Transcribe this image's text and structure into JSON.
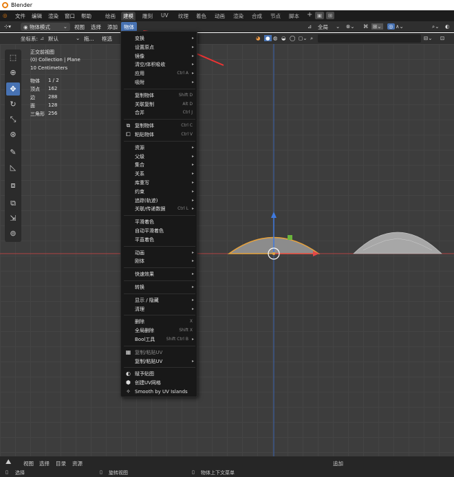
{
  "app": {
    "title": "Blender"
  },
  "topbar": {
    "menus": [
      "文件",
      "编辑",
      "渲染",
      "窗口",
      "帮助"
    ],
    "tabs": [
      "绘画",
      "建模",
      "雕刻",
      "UV",
      "纹理",
      "着色",
      "动画",
      "渲染",
      "合成",
      "节点",
      "脚本"
    ],
    "active_tab": "建模",
    "add_tab": "+"
  },
  "header": {
    "mode": "物体模式",
    "menus": [
      "视图",
      "选择",
      "添加"
    ],
    "active_menu": "物体",
    "orientation": "全局"
  },
  "toolheader": {
    "coord_label": "坐标系:",
    "coord_value": "默认",
    "drag_label": "拖...",
    "select_label": "框选"
  },
  "overlay": {
    "view_name": "正交前视图",
    "collection": "(0) Collection | Plane",
    "scale": "10 Centimeters",
    "stats": [
      {
        "label": "物体",
        "value": "1 / 2"
      },
      {
        "label": "顶点",
        "value": "162"
      },
      {
        "label": "边",
        "value": "288"
      },
      {
        "label": "面",
        "value": "128"
      },
      {
        "label": "三角形",
        "value": "256"
      }
    ]
  },
  "menu": {
    "groups": [
      [
        {
          "label": "变换",
          "submenu": true
        },
        {
          "label": "设置原点",
          "submenu": true
        },
        {
          "label": "镜像",
          "submenu": true
        },
        {
          "label": "清空/体积吸收",
          "submenu": true
        },
        {
          "label": "应用",
          "shortcut": "Ctrl A",
          "submenu": true
        },
        {
          "label": "吸附",
          "submenu": true
        }
      ],
      [
        {
          "label": "复制物体",
          "shortcut": "Shift D"
        },
        {
          "label": "关联复制",
          "shortcut": "Alt D"
        },
        {
          "label": "合并",
          "shortcut": "Ctrl J"
        }
      ],
      [
        {
          "label": "复制物体",
          "shortcut": "Ctrl C",
          "icon": "copy-icon"
        },
        {
          "label": "粘贴物体",
          "shortcut": "Ctrl V",
          "icon": "paste-icon"
        }
      ],
      [
        {
          "label": "资源",
          "submenu": true
        },
        {
          "label": "父级",
          "submenu": true
        },
        {
          "label": "集合",
          "submenu": true
        },
        {
          "label": "关系",
          "submenu": true
        },
        {
          "label": "库重写",
          "submenu": true
        },
        {
          "label": "约束",
          "submenu": true
        },
        {
          "label": "追踪(轨迹)",
          "submenu": true
        },
        {
          "label": "关联/传递数据",
          "shortcut": "Ctrl L",
          "submenu": true
        }
      ],
      [
        {
          "label": "平滑着色"
        },
        {
          "label": "自动平滑着色"
        },
        {
          "label": "平直着色"
        }
      ],
      [
        {
          "label": "动画",
          "submenu": true
        },
        {
          "label": "刚体",
          "submenu": true
        }
      ],
      [
        {
          "label": "快速效果",
          "submenu": true
        }
      ],
      [
        {
          "label": "转换",
          "submenu": true
        }
      ],
      [
        {
          "label": "显示 / 隐藏",
          "submenu": true
        },
        {
          "label": "清理",
          "submenu": true
        }
      ],
      [
        {
          "label": "删除",
          "shortcut": "X"
        },
        {
          "label": "全局删除",
          "shortcut": "Shift X"
        },
        {
          "label": "Bool工具",
          "shortcut": "Shift Ctrl B",
          "submenu": true
        }
      ],
      [
        {
          "label": "复制/粘贴UV",
          "disabled": true,
          "icon": "uv-icon"
        },
        {
          "label": "复制/粘贴UV",
          "submenu": true
        }
      ],
      [
        {
          "label": "赋予贴图",
          "icon": "texture-icon"
        },
        {
          "label": "创建UV网格",
          "icon": "uv-grid-icon"
        },
        {
          "label": "Smooth by UV Islands",
          "icon": "smooth-icon"
        }
      ]
    ]
  },
  "statusbar": {
    "menus": [
      "视图",
      "选择",
      "目录",
      "资源"
    ],
    "add_label": "追加",
    "hints": [
      "选择",
      "旋转视图",
      "物体上下文菜单"
    ]
  },
  "colors": {
    "accent": "#4772b3",
    "selection": "#e8a33d",
    "x_axis": "#c14b4b",
    "y_axis": "#3a6cc9"
  }
}
